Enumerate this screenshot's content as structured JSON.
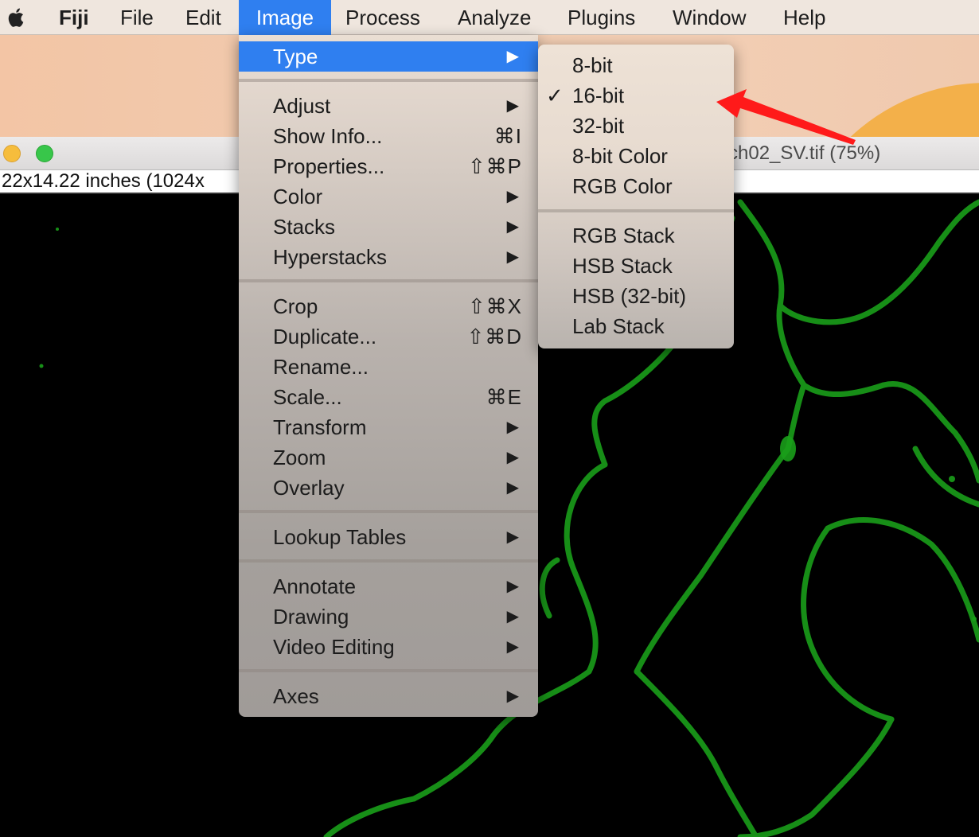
{
  "menubar": {
    "items": [
      "Fiji",
      "File",
      "Edit",
      "Image",
      "Process",
      "Analyze",
      "Plugins",
      "Window",
      "Help"
    ],
    "selected": "Image"
  },
  "image_window": {
    "title": "ch02_SV.tif (75%)",
    "info": "22x14.22 inches (1024x"
  },
  "image_menu": {
    "items": [
      {
        "label": "Type",
        "shortcut": "▶"
      },
      {
        "label": "Adjust",
        "shortcut": "▶"
      },
      {
        "label": "Show Info...",
        "shortcut": "⌘I"
      },
      {
        "label": "Properties...",
        "shortcut": "⇧⌘P"
      },
      {
        "label": "Color",
        "shortcut": "▶"
      },
      {
        "label": "Stacks",
        "shortcut": "▶"
      },
      {
        "label": "Hyperstacks",
        "shortcut": "▶"
      },
      {
        "label": "Crop",
        "shortcut": "⇧⌘X"
      },
      {
        "label": "Duplicate...",
        "shortcut": "⇧⌘D"
      },
      {
        "label": "Rename...",
        "shortcut": ""
      },
      {
        "label": "Scale...",
        "shortcut": "⌘E"
      },
      {
        "label": "Transform",
        "shortcut": "▶"
      },
      {
        "label": "Zoom",
        "shortcut": "▶"
      },
      {
        "label": "Overlay",
        "shortcut": "▶"
      },
      {
        "label": "Lookup Tables",
        "shortcut": "▶"
      },
      {
        "label": "Annotate",
        "shortcut": "▶"
      },
      {
        "label": "Drawing",
        "shortcut": "▶"
      },
      {
        "label": "Video Editing",
        "shortcut": "▶"
      },
      {
        "label": "Axes",
        "shortcut": "▶"
      }
    ]
  },
  "type_submenu": {
    "checkmark": "✓",
    "items": [
      "8-bit",
      "16-bit",
      "32-bit",
      "8-bit Color",
      "RGB Color",
      "RGB Stack",
      "HSB Stack",
      "HSB (32-bit)",
      "Lab Stack"
    ],
    "checked": "16-bit"
  },
  "colors": {
    "highlight": "#2f7ff0",
    "annotation_arrow": "#ff0000",
    "fluorescence": "#1fb51f"
  }
}
